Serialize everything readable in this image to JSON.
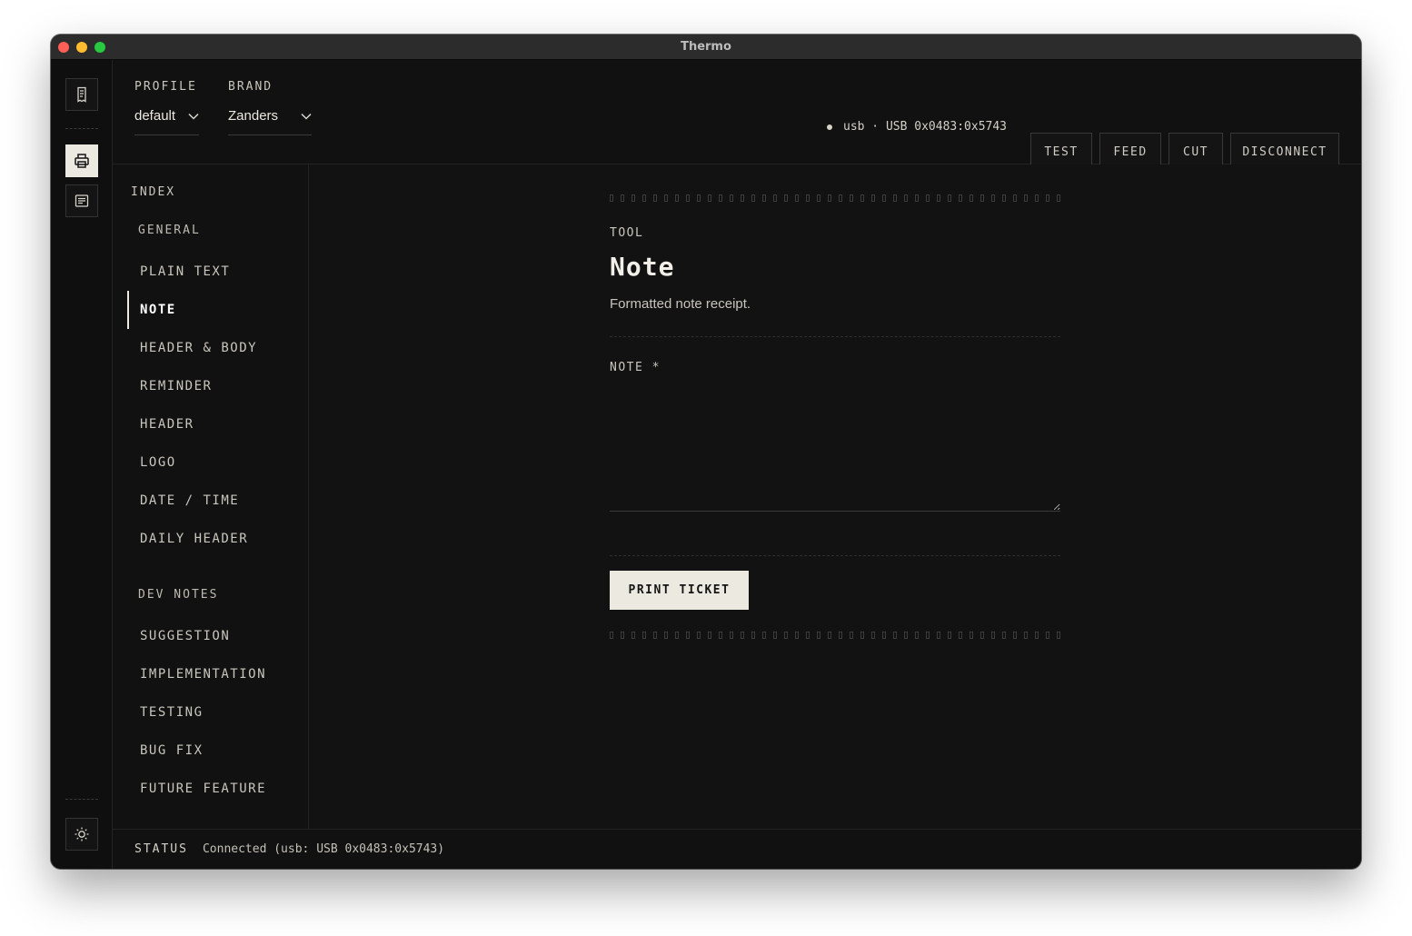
{
  "window": {
    "title": "Thermo"
  },
  "header": {
    "profile_label": "PROFILE",
    "profile_value": "default",
    "brand_label": "BRAND",
    "brand_value": "Zanders",
    "connection": "usb · USB 0x0483:0x5743",
    "buttons": {
      "test": "TEST",
      "feed": "FEED",
      "cut": "CUT",
      "disconnect": "DISCONNECT"
    }
  },
  "index": {
    "title": "INDEX",
    "general_label": "GENERAL",
    "general": [
      "PLAIN TEXT",
      "NOTE",
      "HEADER & BODY",
      "REMINDER",
      "HEADER",
      "LOGO",
      "DATE / TIME",
      "DAILY HEADER"
    ],
    "dev_label": "DEV NOTES",
    "dev": [
      "SUGGESTION",
      "IMPLEMENTATION",
      "TESTING",
      "BUG FIX",
      "FUTURE FEATURE"
    ],
    "active": "NOTE"
  },
  "main": {
    "tool_label": "TOOL",
    "title": "Note",
    "description": "Formatted note receipt.",
    "note_label": "NOTE *",
    "note_value": "",
    "print_button": "PRINT TICKET"
  },
  "status": {
    "label": "STATUS",
    "text": "Connected (usb: USB 0x0483:0x5743)"
  },
  "icons": {
    "rail": [
      "receipt-icon",
      "printer-icon",
      "list-icon"
    ],
    "theme": "sun-icon",
    "select": "chevron-down-icon"
  },
  "colors": {
    "background": "#111111",
    "accent": "#ece9e0"
  }
}
